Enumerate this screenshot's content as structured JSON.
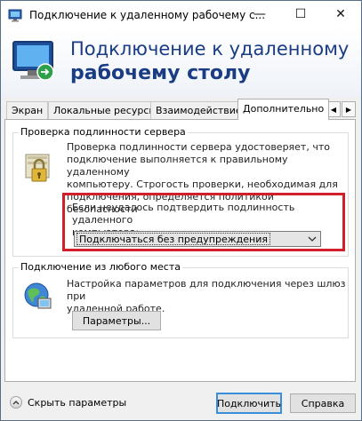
{
  "window": {
    "title": "Подключение к удаленному рабочему с...",
    "minimize_symbol": "—",
    "maximize_symbol": "☐",
    "close_symbol": "✕"
  },
  "banner": {
    "line1": "Подключение к удаленному",
    "line2": "рабочему столу",
    "icon": "remote-desktop-icon"
  },
  "tabs": [
    {
      "label": "Экран",
      "active": false
    },
    {
      "label": "Локальные ресурсы",
      "active": false
    },
    {
      "label": "Взаимодействие",
      "active": false
    },
    {
      "label": "Дополнительно",
      "active": true
    }
  ],
  "tab_scroll": {
    "left": "◀",
    "right": "▶"
  },
  "server_auth": {
    "legend": "Проверка подлинности сервера",
    "description_lines": [
      "Проверка подлинности сервера удостоверяет, что",
      "подключение выполняется к правильному удаленному",
      "компьютеру. Строгость проверки, необходимая для",
      "подключения, определяется политикой безопасности"
    ],
    "prompt_lines": [
      "Если неудалось подтвердить подлинность удаленного",
      "компьютера:"
    ],
    "selected_option": "Подключаться без предупреждения",
    "icon": "lock-icon"
  },
  "anywhere": {
    "legend": "Подключение из любого места",
    "description_lines": [
      "Настройка параметров для подключения через шлюз при",
      "удаленной работе."
    ],
    "settings_button": "Параметры...",
    "icon": "globe-icon"
  },
  "footer": {
    "hide_options": "Скрыть параметры",
    "connect": "Подключить",
    "help": "Справка"
  },
  "colors": {
    "banner_text": "#1a3c84",
    "highlight": "#d21f2c",
    "default_button_border": "#3a8fd8"
  }
}
